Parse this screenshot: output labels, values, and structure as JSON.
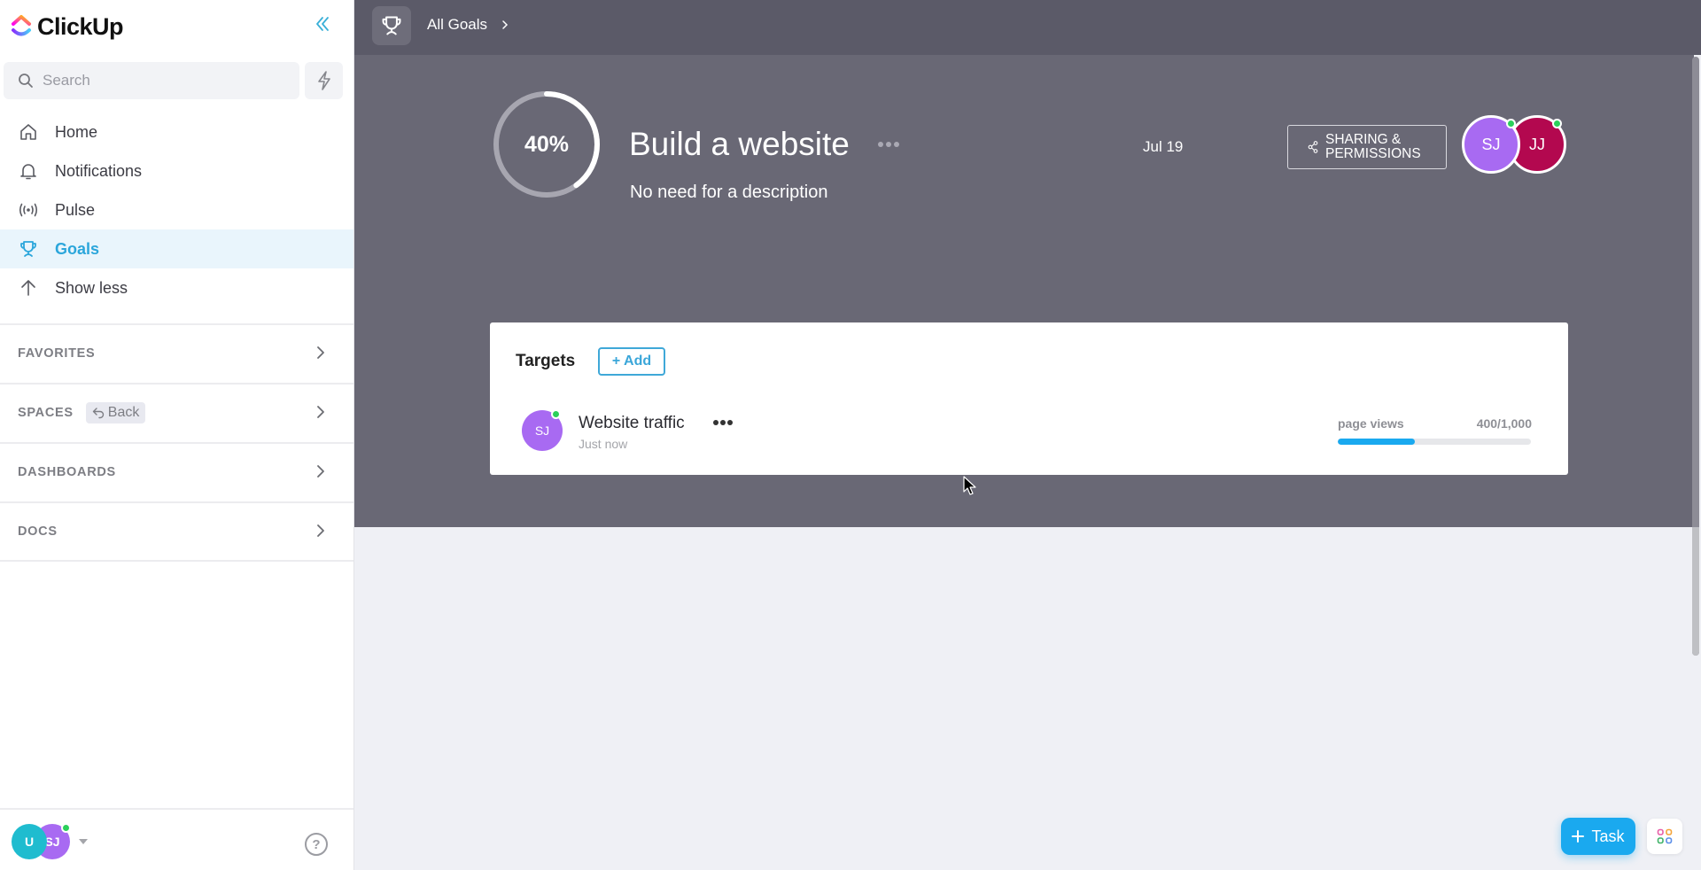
{
  "app": {
    "name": "ClickUp"
  },
  "sidebar": {
    "search_placeholder": "Search",
    "nav": [
      {
        "label": "Home",
        "icon": "home-icon"
      },
      {
        "label": "Notifications",
        "icon": "bell-icon"
      },
      {
        "label": "Pulse",
        "icon": "pulse-icon"
      },
      {
        "label": "Goals",
        "icon": "trophy-icon",
        "active": true
      },
      {
        "label": "Show less",
        "icon": "arrow-up-icon"
      }
    ],
    "sections": [
      {
        "title": "FAVORITES"
      },
      {
        "title": "SPACES",
        "chip": "Back"
      },
      {
        "title": "DASHBOARDS"
      },
      {
        "title": "DOCS"
      }
    ],
    "footer": {
      "user_initial": "U",
      "member_initials": "SJ",
      "help": "?"
    }
  },
  "topbar": {
    "breadcrumb": "All Goals"
  },
  "goal": {
    "progress_percent": 40,
    "progress_label": "40%",
    "title": "Build a website",
    "description": "No need for a description",
    "due_date": "Jul 19",
    "share_label_line1": "SHARING &",
    "share_label_line2": "PERMISSIONS",
    "members": [
      {
        "initials": "SJ",
        "color": "#a86af2",
        "online": true
      },
      {
        "initials": "JJ",
        "color": "#b3084f",
        "online": true
      }
    ]
  },
  "targets": {
    "title": "Targets",
    "add_label": "+ Add",
    "items": [
      {
        "owner_initials": "SJ",
        "owner_color": "#a86af2",
        "name": "Website traffic",
        "updated": "Just now",
        "unit": "page views",
        "current": 400,
        "target": 1000,
        "value_label": "400/1,000"
      }
    ]
  },
  "fab": {
    "task_label": "Task"
  },
  "colors": {
    "accent": "#2ba6db",
    "task_button": "#1aa9ef",
    "hero_bg": "#696875",
    "topbar_bg": "#5b5a68",
    "online": "#2bd05a"
  }
}
